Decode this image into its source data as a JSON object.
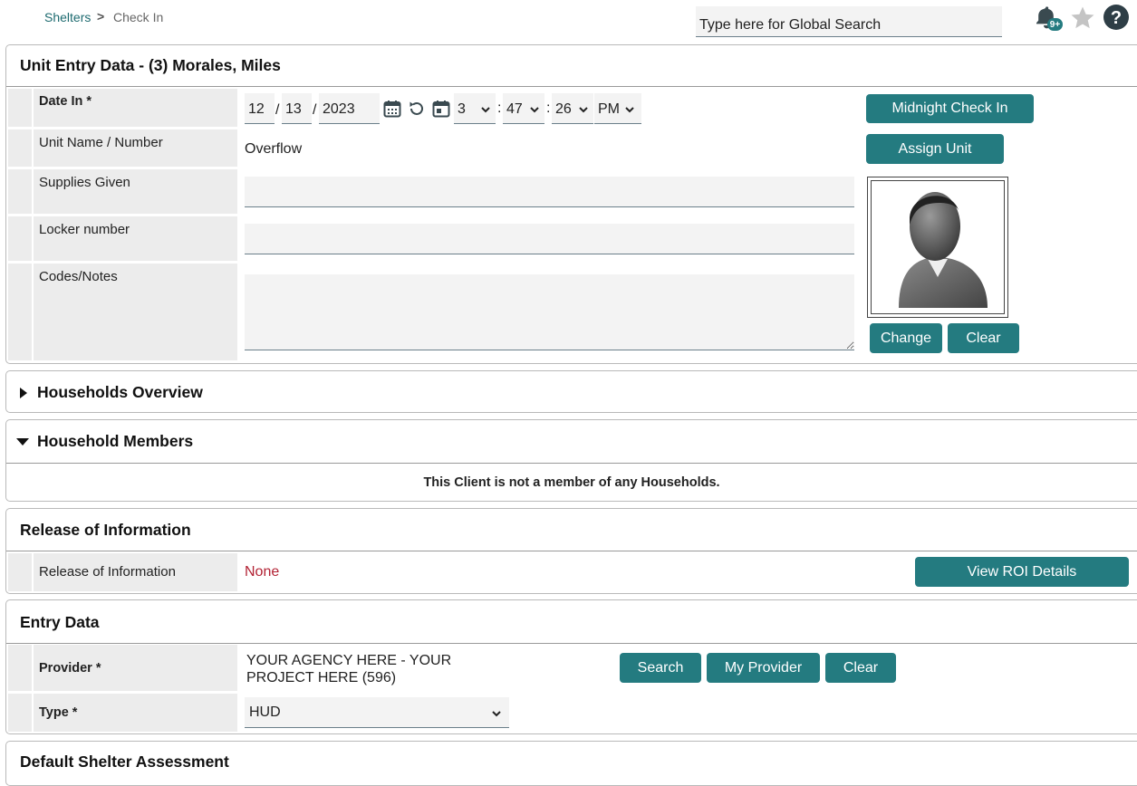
{
  "breadcrumb": {
    "parent": "Shelters",
    "separator": ">",
    "current": "Check In"
  },
  "header": {
    "search_placeholder": "Type here for Global Search",
    "notification_badge": "9+"
  },
  "unit_entry": {
    "title": "Unit Entry Data - (3) Morales, Miles",
    "date_in_label": "Date In *",
    "month": "12",
    "day": "13",
    "year": "2023",
    "hour": "3",
    "minute": "47",
    "second": "26",
    "ampm": "PM",
    "midnight_button": "Midnight Check In",
    "unit_name_label": "Unit Name / Number",
    "unit_name_value": "Overflow",
    "assign_unit_button": "Assign Unit",
    "supplies_label": "Supplies Given",
    "supplies_value": "",
    "locker_label": "Locker number",
    "locker_value": "",
    "codes_label": "Codes/Notes",
    "codes_value": "",
    "photo_change_button": "Change",
    "photo_clear_button": "Clear"
  },
  "households_overview": {
    "title": "Households Overview",
    "expanded": false
  },
  "household_members": {
    "title": "Household Members",
    "expanded": true,
    "message": "This Client is not a member of any Households."
  },
  "release_of_information": {
    "title": "Release of Information",
    "label": "Release of Information",
    "value": "None",
    "value_color": "#b22234",
    "view_button": "View ROI Details"
  },
  "entry_data": {
    "title": "Entry Data",
    "provider_label": "Provider *",
    "provider_value_line1": "YOUR AGENCY HERE - YOUR",
    "provider_value_line2": "PROJECT HERE (596)",
    "search_button": "Search",
    "my_provider_button": "My Provider",
    "clear_button": "Clear",
    "type_label": "Type *",
    "type_value": "HUD"
  },
  "default_shelter_assessment": {
    "title": "Default Shelter Assessment"
  },
  "colors": {
    "accent": "#247b80",
    "link": "#1e6b70",
    "field_bg": "#f3f3f3"
  }
}
